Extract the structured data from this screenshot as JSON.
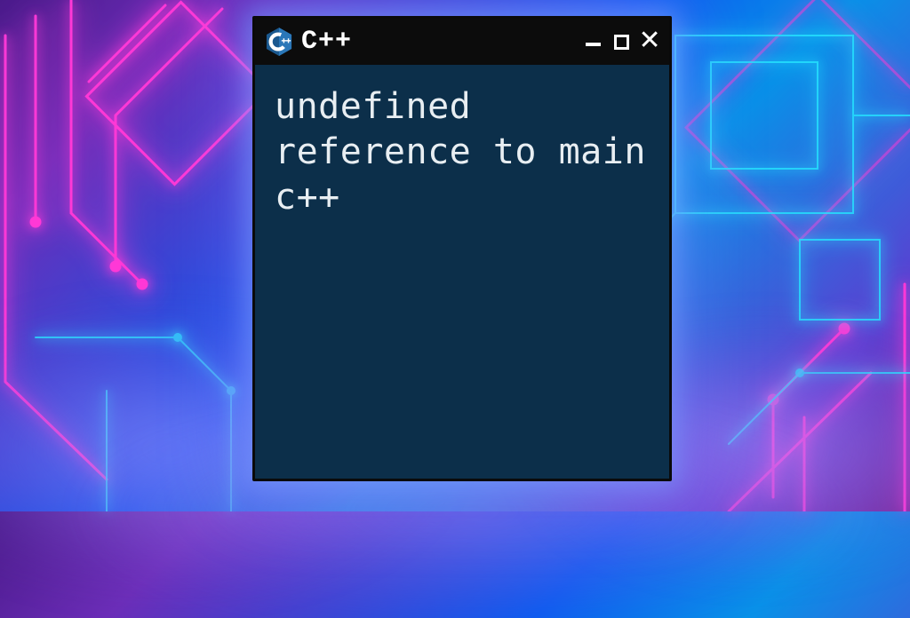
{
  "window": {
    "app_title": "C++",
    "body_text": "undefined reference to main c++",
    "icon_label": "C++",
    "colors": {
      "titlebar": "#0c0c0c",
      "body_bg": "#0c2f4a",
      "text": "#e8eef2"
    }
  }
}
